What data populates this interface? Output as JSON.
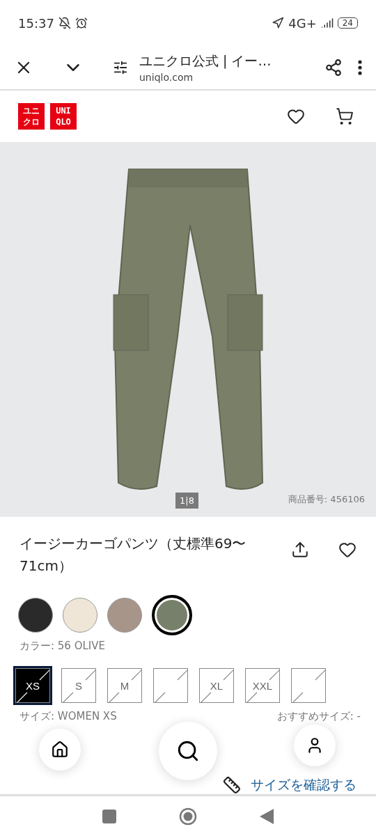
{
  "status_bar": {
    "time": "15:37",
    "network": "4G+",
    "battery": "24"
  },
  "browser_bar": {
    "title": "ユニクロ公式 | イー…",
    "url": "uniqlo.com"
  },
  "header": {
    "logo": [
      {
        "lines": [
          "ユニ",
          "クロ"
        ]
      },
      {
        "lines": [
          "UNI",
          "QLO"
        ]
      }
    ]
  },
  "gallery": {
    "counter": "1|8",
    "product_code": "商品番号: 456106"
  },
  "product": {
    "name": "イージーカーゴパンツ（丈標準69〜71cm）",
    "favorite": false
  },
  "colors": [
    {
      "color": "#2a2a2a",
      "selected": false
    },
    {
      "color": "#efe6d8",
      "selected": false
    },
    {
      "color": "#a8958a",
      "selected": false
    },
    {
      "color": "#77806a",
      "selected": true
    }
  ],
  "color_label": "カラー: 56 OLIVE",
  "sizes": [
    {
      "label": "XS",
      "selected": true,
      "available": false
    },
    {
      "label": "S",
      "selected": false,
      "available": false
    },
    {
      "label": "M",
      "selected": false,
      "available": false
    },
    {
      "selected": false,
      "available": false
    },
    {
      "label": "XL",
      "selected": false,
      "available": false
    },
    {
      "label": "XXL",
      "selected": false,
      "available": false
    },
    {
      "selected": false,
      "available": false
    }
  ],
  "size_label": "サイズ: WOMEN XS",
  "recommended_size": "おすすめサイズ: -",
  "size_link": "サイズを確認する"
}
